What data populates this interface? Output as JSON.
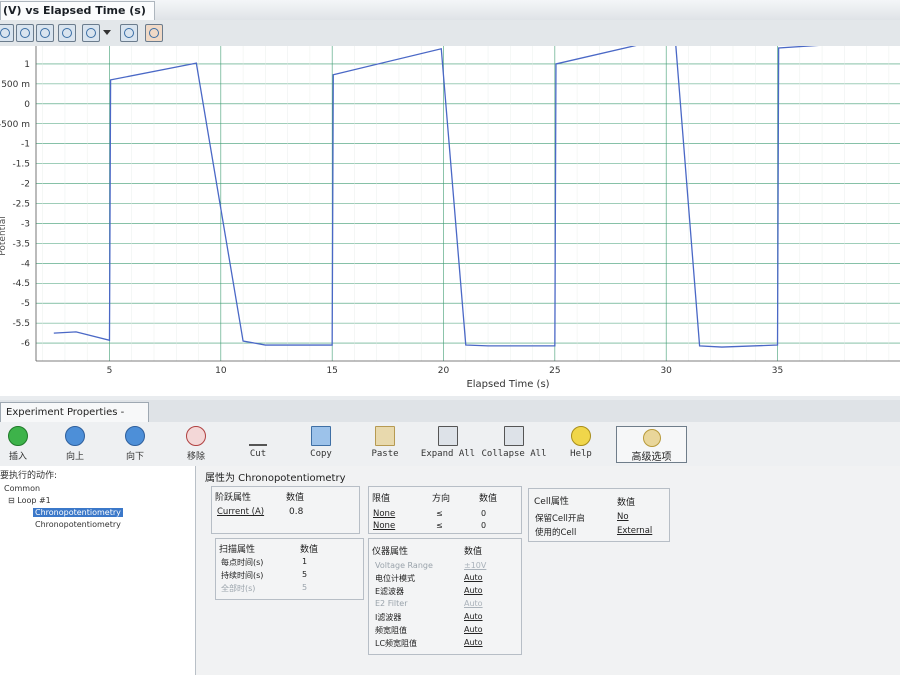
{
  "window": {
    "title": "(V) vs Elapsed Time (s)"
  },
  "chart_data": {
    "type": "line",
    "title": "",
    "xlabel": "Elapsed Time (s)",
    "ylabel": "Potential",
    "xlim": [
      1.7,
      40.5
    ],
    "ylim": [
      -6.45,
      1.45
    ],
    "x_ticks": [
      5,
      10,
      15,
      20,
      25,
      30,
      35
    ],
    "y_tick_labels": [
      "1",
      "500 m",
      "0",
      "-500 m",
      "-1",
      "-1.5",
      "-2",
      "-2.5",
      "-3",
      "-3.5",
      "-4",
      "-4.5",
      "-5",
      "-5.5",
      "-6"
    ],
    "y_tick_values": [
      1,
      0.5,
      0,
      -0.5,
      -1,
      -1.5,
      -2,
      -2.5,
      -3,
      -3.5,
      -4,
      -4.5,
      -5,
      -5.5,
      -6
    ],
    "grid": true,
    "series": [
      {
        "color": "#4a68c6",
        "x": [
          2.5,
          3.5,
          5.0,
          5.05,
          8.9,
          11.0,
          12.0,
          15.0,
          15.05,
          19.9,
          21.0,
          22.0,
          25.0,
          25.05,
          30.4,
          31.5,
          32.5,
          35.0,
          35.05,
          40.5
        ],
        "y": [
          -5.75,
          -5.72,
          -5.93,
          0.6,
          1.02,
          -5.95,
          -6.05,
          -6.05,
          0.73,
          1.38,
          -6.05,
          -6.07,
          -6.07,
          1.0,
          1.69,
          -6.07,
          -6.1,
          -6.05,
          1.4,
          1.6
        ]
      }
    ]
  },
  "panel": {
    "tab": "Experiment Properties - Data Ac..."
  },
  "ribbon": {
    "insert": "插入",
    "up": "向上",
    "down": "向下",
    "remove": "移除",
    "cut": "Cut",
    "copy": "Copy",
    "paste": "Paste",
    "expand_all": "Expand All",
    "collapse_all": "Collapse All",
    "help": "Help",
    "advanced": "高级选项"
  },
  "tree": {
    "title": "要执行的动作:",
    "common": "Common",
    "loop": "Loop #1",
    "selected": "Chronopotentiometry",
    "second": "Chronopotentiometry"
  },
  "props": {
    "title": "属性为 Chronopotentiometry",
    "control": {
      "h1": "阶跃属性",
      "h2": "数值",
      "label": "Current (A)",
      "value": "0.8"
    },
    "scan": {
      "h1": "扫描属性",
      "h2": "数值",
      "rows": [
        [
          "每点时间(s)",
          "1"
        ],
        [
          "持续时间(s)",
          "5"
        ],
        [
          "全部时(s)",
          "5"
        ]
      ]
    },
    "limit": {
      "h1": "限值",
      "h2": "方向",
      "h3": "数值",
      "rows": [
        [
          "None",
          "≤",
          "0"
        ],
        [
          "None",
          "≤",
          "0"
        ]
      ]
    },
    "instr": {
      "h1": "仪器属性",
      "h2": "数值",
      "rows": [
        [
          "Voltage Range",
          "±10V"
        ],
        [
          "电位计模式",
          "Auto"
        ],
        [
          "E滤波器",
          "Auto"
        ],
        [
          "E2 Filter",
          "Auto"
        ],
        [
          "I滤波器",
          "Auto"
        ],
        [
          "频宽阻值",
          "Auto"
        ],
        [
          "LC频宽阻值",
          "Auto"
        ]
      ]
    },
    "cell": {
      "h1": "Cell属性",
      "h2": "数值",
      "rows": [
        [
          "保留Cell开启",
          "No"
        ],
        [
          "使用的Cell",
          "External"
        ]
      ]
    }
  }
}
